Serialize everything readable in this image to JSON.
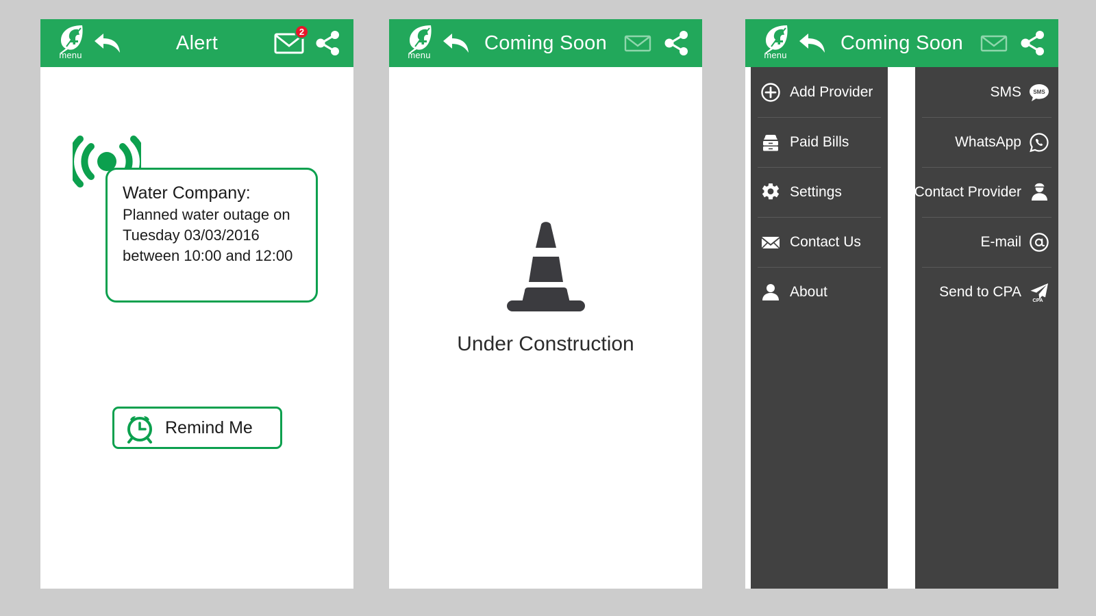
{
  "colors": {
    "brand_green": "#22a85b",
    "accent_green": "#0ca04e",
    "badge_red": "#e8162a",
    "drawer_dark": "#414141",
    "page_background": "#cccccc",
    "text_dark": "#1b1b1b"
  },
  "panel1": {
    "header": {
      "logo_label": "menu",
      "logo_icon": "leaf-currency-logo-icon",
      "back_icon": "back-arrow-icon",
      "title": "Alert",
      "mail_icon": "envelope-icon",
      "mail_badge_count": "2",
      "share_icon": "share-icon"
    },
    "alert": {
      "signal_icon": "broadcast-signal-icon",
      "title": "Water Company:",
      "lines": [
        "Planned water outage on",
        "Tuesday 03/03/2016",
        "between 10:00 and 12:00"
      ]
    },
    "remind_button": {
      "icon": "alarm-clock-icon",
      "label": "Remind Me"
    }
  },
  "panel2": {
    "header": {
      "logo_label": "menu",
      "logo_icon": "leaf-currency-logo-icon",
      "back_icon": "back-arrow-icon",
      "title": "Coming Soon",
      "mail_icon": "envelope-icon",
      "share_icon": "share-icon"
    },
    "content": {
      "icon": "traffic-cone-icon",
      "label": "Under Construction"
    }
  },
  "panel3": {
    "header": {
      "logo_label": "menu",
      "logo_icon": "leaf-currency-logo-icon",
      "back_icon": "back-arrow-icon",
      "title": "Coming Soon",
      "mail_icon": "envelope-icon",
      "share_icon": "share-icon"
    },
    "left_drawer": {
      "items": [
        {
          "label": "Add Provider",
          "icon": "plus-circle-icon"
        },
        {
          "label": "Paid Bills",
          "icon": "file-cabinet-icon"
        },
        {
          "label": "Settings",
          "icon": "gear-icon"
        },
        {
          "label": "Contact Us",
          "icon": "envelope-icon"
        },
        {
          "label": "About",
          "icon": "person-icon"
        }
      ]
    },
    "right_drawer": {
      "items": [
        {
          "label": "SMS",
          "icon": "sms-bubble-icon"
        },
        {
          "label": "WhatsApp",
          "icon": "whatsapp-icon"
        },
        {
          "label": "Contact Provider",
          "icon": "contact-person-icon"
        },
        {
          "label": "E-mail",
          "icon": "at-sign-icon"
        },
        {
          "label": "Send to CPA",
          "icon": "send-cpa-icon"
        }
      ]
    }
  }
}
